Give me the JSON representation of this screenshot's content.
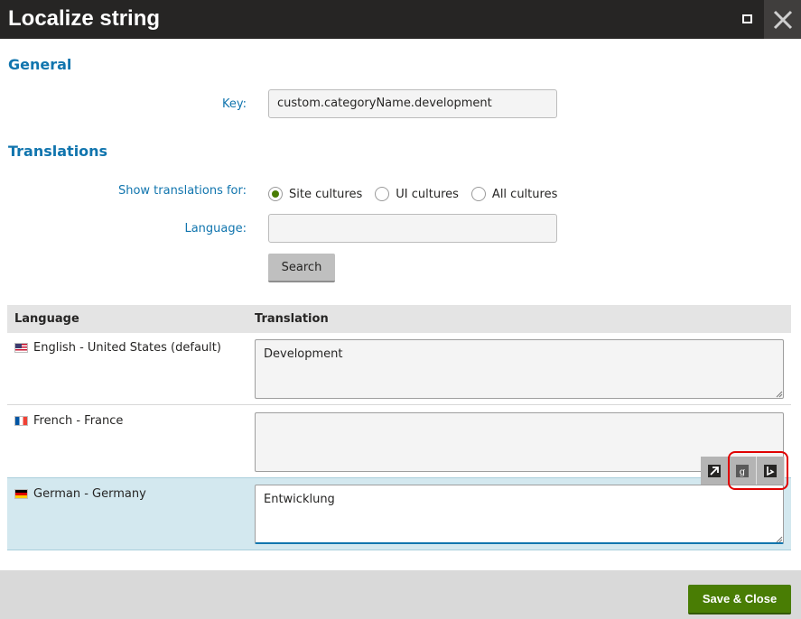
{
  "dialog": {
    "title": "Localize string"
  },
  "general": {
    "heading": "General",
    "key_label": "Key:",
    "key_value": "custom.categoryName.development"
  },
  "translations": {
    "heading": "Translations",
    "show_label": "Show translations for:",
    "radios": [
      {
        "label": "Site cultures",
        "checked": true
      },
      {
        "label": "UI cultures",
        "checked": false
      },
      {
        "label": "All cultures",
        "checked": false
      }
    ],
    "language_label": "Language:",
    "language_value": "",
    "search_label": "Search"
  },
  "grid": {
    "columns": [
      "Language",
      "Translation"
    ],
    "rows": [
      {
        "language": "English - United States (default)",
        "flag": "us-flag-icon",
        "translation": "Development"
      },
      {
        "language": "French - France",
        "flag": "fr-flag-icon",
        "translation": ""
      },
      {
        "language": "German - Germany",
        "flag": "de-flag-icon",
        "translation": "Entwicklung",
        "selected": true
      }
    ]
  },
  "toolbar": {
    "tools": [
      "open-in-window-icon",
      "google-translate-icon",
      "bing-translate-icon"
    ]
  },
  "footer": {
    "save_label": "Save & Close"
  },
  "colors": {
    "accent": "#1175ae",
    "save": "#497d04",
    "titlebar": "#262524",
    "highlight": "#e00000"
  }
}
